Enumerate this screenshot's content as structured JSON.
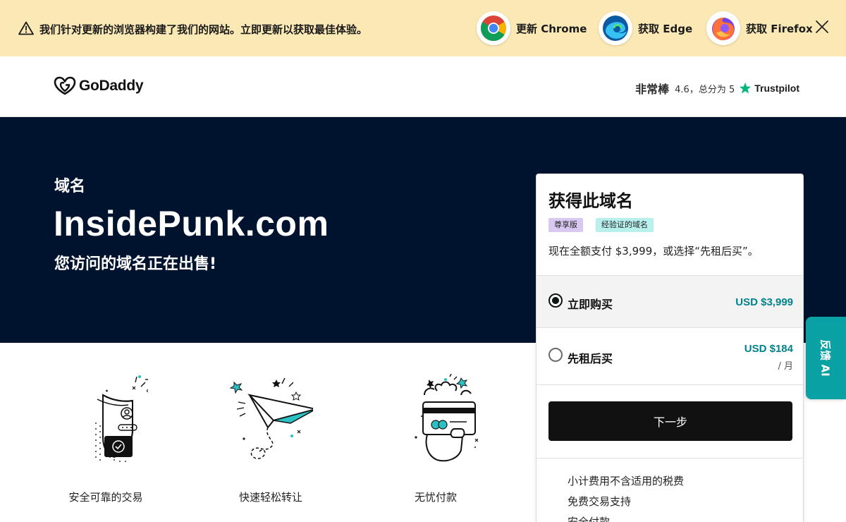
{
  "banner": {
    "message": "我们针对更新的浏览器构建了我们的网站。立即更新以获取最佳体验。",
    "browsers": [
      {
        "label": "更新 Chrome",
        "icon": "chrome-icon"
      },
      {
        "label": "获取 Edge",
        "icon": "edge-icon"
      },
      {
        "label": "获取 Firefox",
        "icon": "firefox-icon"
      }
    ],
    "close_icon": "close-icon",
    "warning_icon": "warning-icon"
  },
  "header": {
    "brand": "GoDaddy",
    "rating": {
      "label": "非常棒",
      "score_text": "4.6，总分为 5",
      "provider": "Trustpilot",
      "star_color": "#00b67a"
    }
  },
  "hero": {
    "kind": "域名",
    "domain": "InsidePunk.com",
    "subtitle": "您访问的域名正在出售!",
    "background": "#00132e"
  },
  "features": [
    {
      "label": "安全可靠的交易",
      "icon": "secure-shield-icon"
    },
    {
      "label": "快速轻松转让",
      "icon": "paper-plane-icon"
    },
    {
      "label": "无忧付款",
      "icon": "payment-card-hand-icon"
    }
  ],
  "purchase": {
    "title": "获得此域名",
    "badges": [
      "尊享版",
      "经验证的域名"
    ],
    "description": "现在全额支付 $3,999，或选择“先租后买”。",
    "options": [
      {
        "label": "立即购买",
        "price": "USD $3,999",
        "selected": true
      },
      {
        "label": "先租后买",
        "price": "USD $184",
        "period": "/ 月",
        "selected": false
      }
    ],
    "next_label": "下一步",
    "notes": [
      "小计费用不含适用的税费",
      "免费交易支持",
      "安全付款"
    ]
  },
  "feedback_tab": {
    "label": "反馈 AI"
  },
  "colors": {
    "banner_bg": "#fbe9b5",
    "accent_teal": "#00838c",
    "button_dark": "#111111"
  }
}
